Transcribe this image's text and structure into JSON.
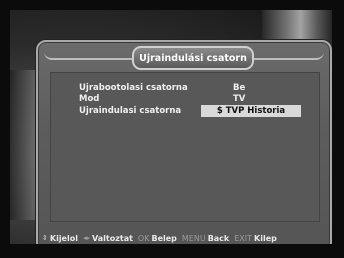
{
  "menu": {
    "title": "Ujraindulási csatorn",
    "rows": [
      {
        "label": "Ujrabootolasi csatorna",
        "value": "Be"
      },
      {
        "label": "Mod",
        "value": "TV"
      },
      {
        "label": "Ujraindulasi csatorna",
        "value": "$ TVP Historia"
      }
    ]
  },
  "footer": {
    "select_icon": "up-down-arrows-icon",
    "select_label": "Kijelol",
    "change_icon": "left-right-arrows-icon",
    "change_label": "Valtoztat",
    "ok_key": "OK",
    "ok_label": "Belep",
    "menu_key": "MENU",
    "menu_label": "Back",
    "exit_key": "EXIT",
    "exit_label": "Kilep"
  }
}
